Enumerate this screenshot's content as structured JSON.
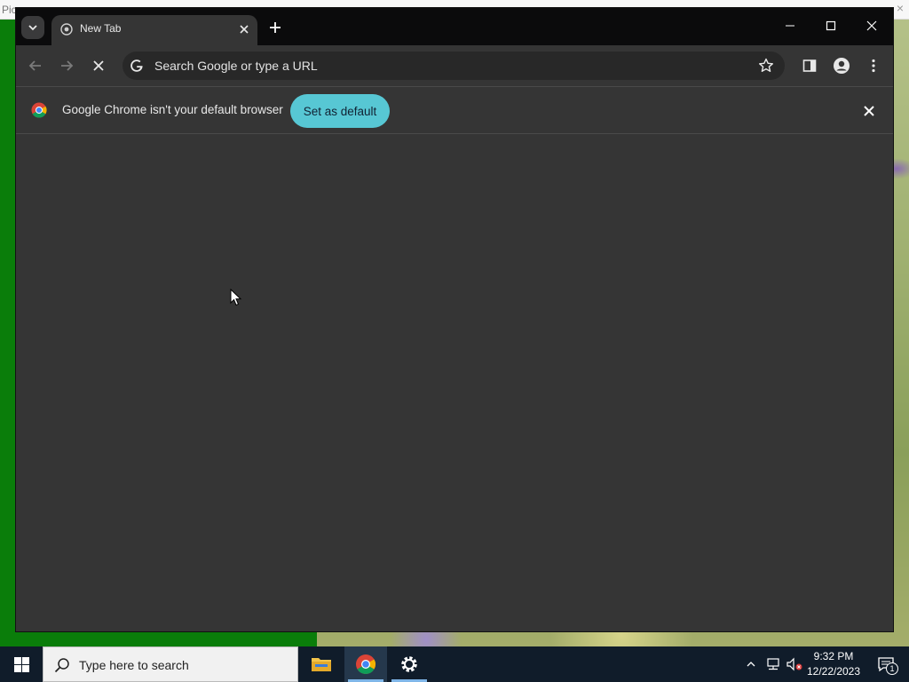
{
  "desktop": {
    "background_window_title": "Pic",
    "background_close_glyph": "×"
  },
  "chrome": {
    "tab": {
      "title": "New Tab",
      "favicon": "chrome-favicon"
    },
    "omnibox": {
      "placeholder": "Search Google or type a URL"
    },
    "infobar": {
      "message": "Google Chrome isn't your default browser",
      "button_label": "Set as default"
    },
    "colors": {
      "frame": "#0b0b0c",
      "toolbar": "#353535",
      "omnibox": "#282828",
      "accent_button": "#57c7d4"
    },
    "icons": [
      "tab-search-icon",
      "close-icon",
      "plus-icon",
      "minimize-icon",
      "maximize-icon",
      "back-arrow-icon",
      "forward-arrow-icon",
      "stop-icon",
      "google-g-icon",
      "star-icon",
      "side-panel-icon",
      "profile-icon",
      "kebab-menu-icon"
    ]
  },
  "taskbar": {
    "search_placeholder": "Type here to search",
    "apps": [
      "file-explorer-icon",
      "chrome-icon",
      "settings-gear-icon"
    ],
    "clock": {
      "time": "9:32 PM",
      "date": "12/22/2023"
    },
    "notification_count": "1",
    "colors": {
      "background": "#101c2a",
      "active_underline": "#7fb6e8"
    }
  }
}
